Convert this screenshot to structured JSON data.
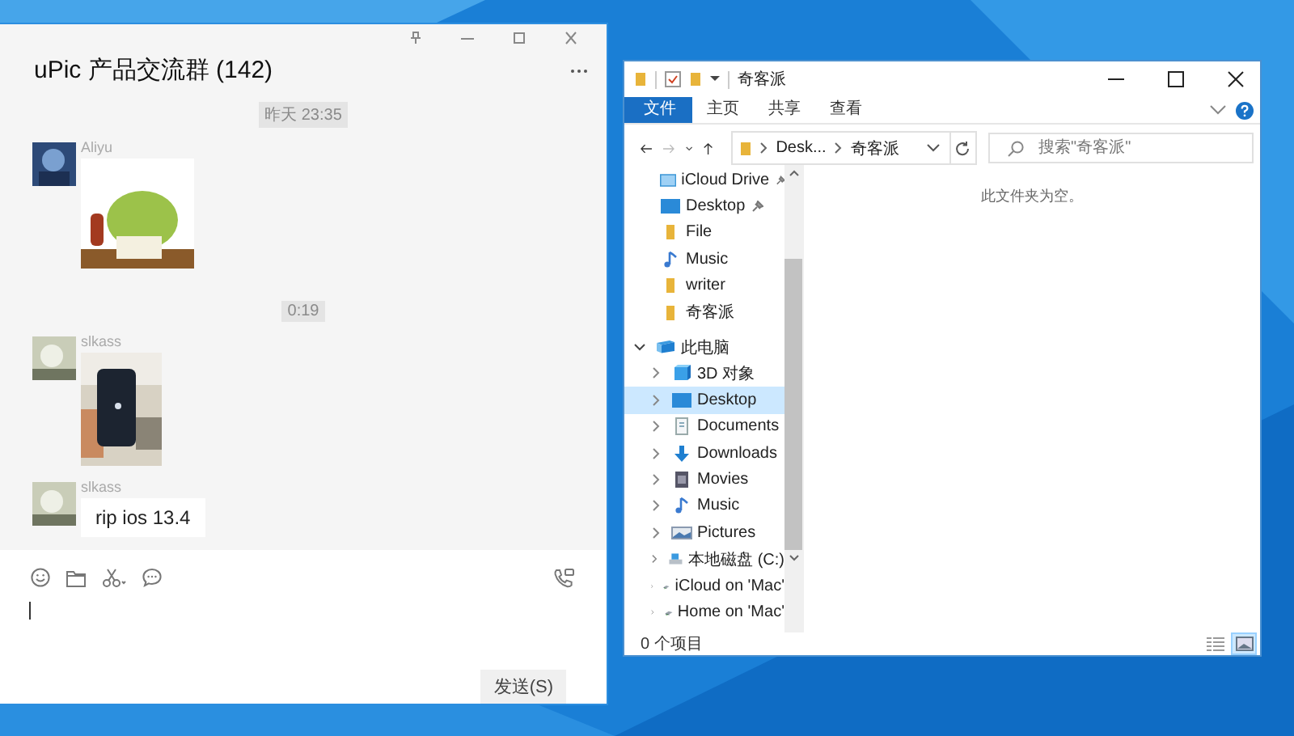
{
  "chat": {
    "title": "uPic 产品交流群 (142)",
    "timeline": [
      {
        "kind": "time",
        "text": "昨天 23:35"
      },
      {
        "kind": "sticker",
        "sender": "Aliyu"
      },
      {
        "kind": "time",
        "text": "0:19"
      },
      {
        "sender": "slkass"
      },
      {
        "kind": "text",
        "sender": "slkass",
        "text": "rip ios 13.4"
      }
    ],
    "send_button": "发送(S)"
  },
  "explorer": {
    "title": "奇客派",
    "ribbon_tabs": [
      {
        "label": "文件",
        "selected": true
      },
      {
        "label": "主页",
        "selected": false
      },
      {
        "label": "共享",
        "selected": false
      },
      {
        "label": "查看",
        "selected": false
      }
    ],
    "address": [
      "Desk...",
      "奇客派"
    ],
    "search": {
      "placeholder": "搜索\"奇客派\""
    },
    "quick_access": [
      {
        "label": "iCloud Drive",
        "kind": "cloud",
        "pinned": true
      },
      {
        "label": "Desktop",
        "kind": "desktop",
        "pinned": true
      },
      {
        "label": "File",
        "kind": "folder",
        "pinned": false
      },
      {
        "label": "Music",
        "kind": "music",
        "pinned": false
      },
      {
        "label": "writer",
        "kind": "folder",
        "pinned": false
      },
      {
        "label": "奇客派",
        "kind": "folder",
        "pinned": false
      }
    ],
    "tree": [
      {
        "label": "此电脑",
        "kind": "pc",
        "expanded": true,
        "selected": false,
        "children": [
          {
            "label": "3D 对象",
            "kind": "objects",
            "expanded": false,
            "selected": false
          },
          {
            "label": "Desktop",
            "kind": "desktop",
            "expanded": false,
            "selected": true
          },
          {
            "label": "Documents",
            "kind": "documents",
            "expanded": false,
            "selected": false
          },
          {
            "label": "Downloads",
            "kind": "downloads",
            "expanded": false,
            "selected": false
          },
          {
            "label": "Movies",
            "kind": "movies",
            "expanded": false,
            "selected": false
          },
          {
            "label": "Music",
            "kind": "music",
            "expanded": false,
            "selected": false
          },
          {
            "label": "Pictures",
            "kind": "pictures",
            "expanded": false,
            "selected": false
          },
          {
            "label": "本地磁盘 (C:)",
            "kind": "drive",
            "expanded": false,
            "selected": false
          },
          {
            "label": "iCloud on 'Mac'",
            "kind": "network",
            "expanded": false,
            "selected": false
          },
          {
            "label": "Home on 'Mac'",
            "kind": "network",
            "expanded": false,
            "selected": false
          }
        ]
      }
    ],
    "empty_message": "此文件夹为空。",
    "status": "0 个项目",
    "views": [
      {
        "kind": "details",
        "selected": false
      },
      {
        "kind": "large",
        "selected": true
      }
    ]
  }
}
